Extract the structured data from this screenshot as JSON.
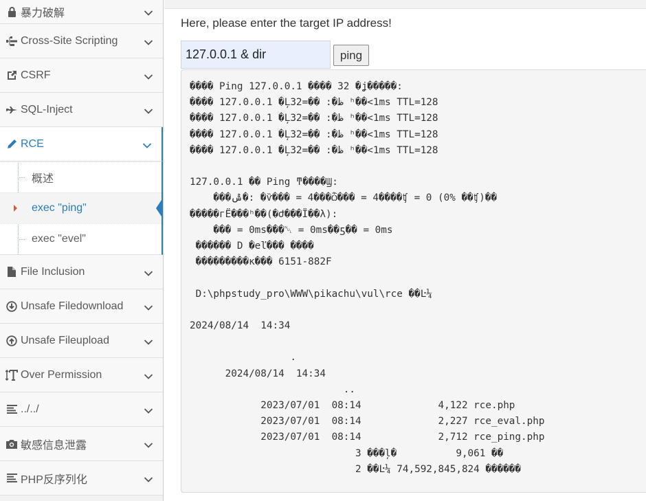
{
  "sidebar": {
    "items": [
      {
        "label": "暴力破解",
        "icon": "lock-icon"
      },
      {
        "label": "Cross-Site Scripting",
        "icon": "sitemap-icon"
      },
      {
        "label": "CSRF",
        "icon": "share-icon"
      },
      {
        "label": "SQL-Inject",
        "icon": "fighter-jet-icon"
      },
      {
        "label": "RCE",
        "icon": "pencil-icon"
      },
      {
        "label": "File Inclusion",
        "icon": "file-icon"
      },
      {
        "label": "Unsafe Filedownload",
        "icon": "download-circle-icon"
      },
      {
        "label": "Unsafe Fileupload",
        "icon": "upload-circle-icon"
      },
      {
        "label": "Over Permission",
        "icon": "text-height-icon"
      },
      {
        "label": "../../",
        "icon": "align-left-icon"
      },
      {
        "label": "敏感信息泄露",
        "icon": "camera-icon"
      },
      {
        "label": "PHP反序列化",
        "icon": "align-left-icon"
      }
    ],
    "rce_submenu": [
      {
        "label": "概述"
      },
      {
        "label": "exec \"ping\""
      },
      {
        "label": "exec \"evel\""
      }
    ],
    "active_item": "RCE",
    "active_subitem": "exec \"ping\""
  },
  "main": {
    "prompt": "Here, please enter the target IP address!",
    "ip_input_value": "127.0.0.1 & dir",
    "ping_button": "ping",
    "output": "���� Ping 127.0.0.1 ���� 32 �ֽ�����:\n���� 127.0.0.1 �Ļظ�: �ֽ�=32 ʱ��<1ms TTL=128\n���� 127.0.0.1 �Ļظ�: �ֽ�=32 ʱ��<1ms TTL=128\n���� 127.0.0.1 �Ļظ�: �ֽ�=32 ʱ��<1ms TTL=128\n���� 127.0.0.1 �Ļظ�: �ֽ�=32 ʱ��<1ms TTL=128\n\n127.0.0.1 �� Ping ͳ����Ϣ:\n    ���ݰ�: �ѷ��� = 4���ѽ��� = 4����ʧ = 0 (0% ��ʧ)��\n�����г̵Ĺ���ʱ��(�Ժ���Ϊ��λ):\n    ��� = 0ms��� = 0ms��ƽ�� = 0ms\n ������ D �еľ��� ����\n ���������к��� 6151-882F\n\n D:\\phpstudy_pro\\WWW\\pikachu\\vul\\rce ��Ŀ¼\n\n2024/08/14  14:34    <DIR>          .\n2024/08/14  14:34    <DIR>          ..\n2023/07/01  08:14             4,122 rce.php\n2023/07/01  08:14             2,227 rce_eval.php\n2023/07/01  08:14             2,712 rce_ping.php\n               3 ���ļ�          9,061 �ֽ�\n               2 ��Ŀ¼ 74,592,845,824 �����ֽ�",
    "output_display": "���� Ping 127.0.0.1 ���� 32 �ʝ�����:\n���� 127.0.0.1 �Ļ32=�� :�ظ ʰ��<1ms TTL=128\n���� 127.0.0.1 �Ļ32=�� :�ظ ʰ��<1ms TTL=128\n���� 127.0.0.1 �Ļ32=�� :�ظ ʰ��<1ms TTL=128\n���� 127.0.0.1 �Ļ32=�� :�ظ ʰ��<1ms TTL=128\n\n127.0.0.1 �� Ping ͳ����Ϣ:\n    ���ݰ�: �ѷ��� = 4���ѽ��� = 4����ʧ = 0 (0% ��ʧ)��\n�����гЁ���ʰ��(�Ժ���Ϊ��λ):\n    ��� = 0ms���␀ = 0ms��ƽ�� = 0ms\n ������ D �еľ��� ����\n ���������к��� 6151-882F\n\n D:\\phpstudy_pro\\WWW\\pikachu\\vul\\rce ��Ŀ¼\n\n2024/08/14  14:34\n\n                 .\n      2024/08/14  14:34\n                          ..\n            2023/07/01  08:14             4,122 rce.php\n            2023/07/01  08:14             2,227 rce_eval.php\n            2023/07/01  08:14             2,712 rce_ping.php\n                            3 ���ļ�          9,061 ��\n                            2 ��Ŀ¼ 74,592,845,824 ������"
  }
}
